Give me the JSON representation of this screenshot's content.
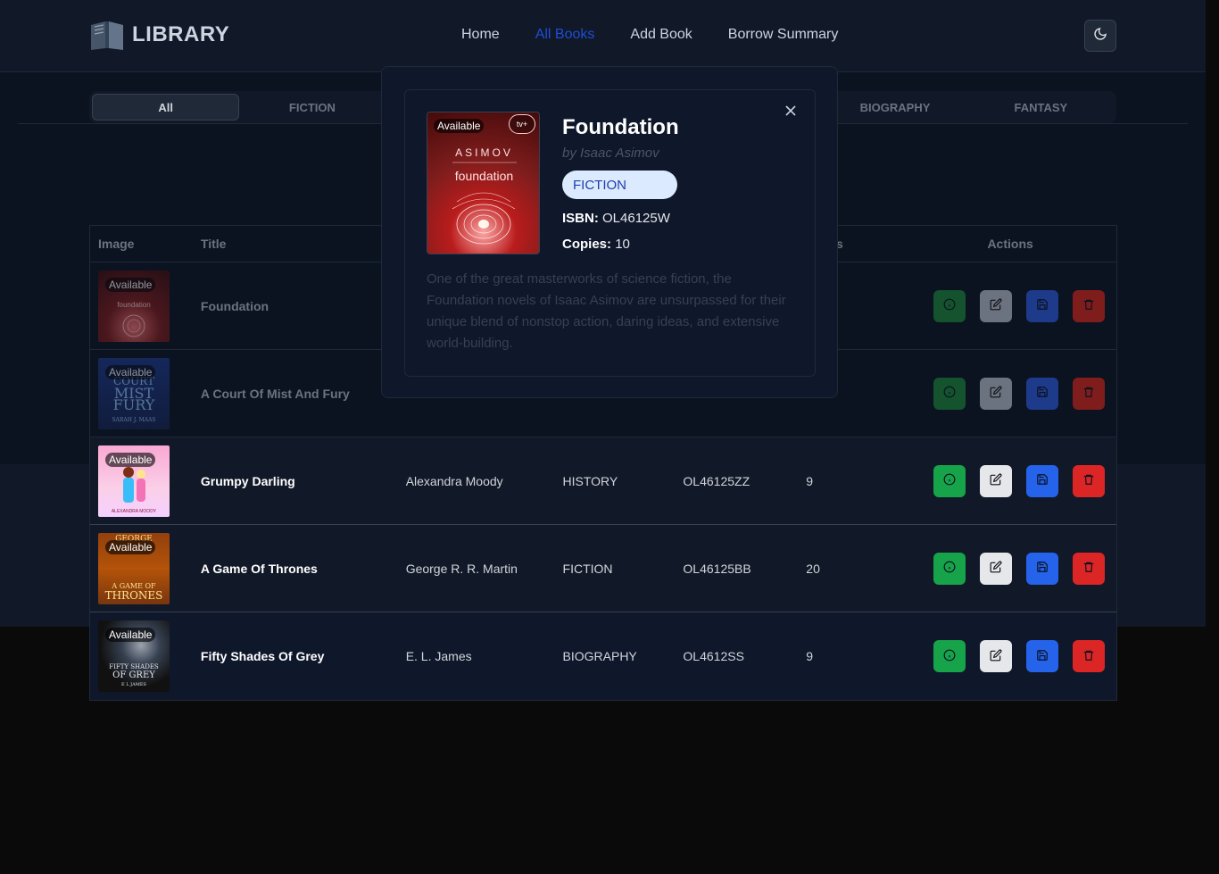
{
  "brand": {
    "name": "LIBRARY"
  },
  "nav": [
    {
      "label": "Home",
      "active": false
    },
    {
      "label": "All Books",
      "active": true
    },
    {
      "label": "Add Book",
      "active": false
    },
    {
      "label": "Borrow Summary",
      "active": false
    }
  ],
  "tabs": [
    "All",
    "FICTION",
    "",
    "",
    "",
    "BIOGRAPHY",
    "FANTASY"
  ],
  "table": {
    "headers": {
      "image": "Image",
      "title": "Title",
      "copies": "ies",
      "actions": "Actions"
    },
    "rows": [
      {
        "status": "Available",
        "title": "Foundation",
        "author": "",
        "genre": "",
        "isbn": "",
        "copies": ""
      },
      {
        "status": "Available",
        "title": "A Court Of Mist And Fury",
        "author": "",
        "genre": "",
        "isbn": "",
        "copies": ""
      },
      {
        "status": "Available",
        "title": "Grumpy Darling",
        "author": "Alexandra Moody",
        "genre": "HISTORY",
        "isbn": "OL46125ZZ",
        "copies": "9"
      },
      {
        "status": "Available",
        "title": "A Game Of Thrones",
        "author": "George R. R. Martin",
        "genre": "FICTION",
        "isbn": "OL46125BB",
        "copies": "20"
      },
      {
        "status": "Available",
        "title": "Fifty Shades Of Grey",
        "author": "E. L. James",
        "genre": "BIOGRAPHY",
        "isbn": "OL4612SS",
        "copies": "9"
      }
    ]
  },
  "modal": {
    "status": "Available",
    "title": "Foundation",
    "author": "by Isaac Asimov",
    "genre": "FICTION",
    "isbn_label": "ISBN:",
    "isbn": "OL46125W",
    "copies_label": "Copies:",
    "copies": "10",
    "description": "One of the great masterworks of science fiction, the Foundation novels of Isaac Asimov are unsurpassed for their unique blend of nonstop action, daring ideas, and extensive world-building.",
    "cover_text": {
      "top": "ASIMOV",
      "main": "foundation",
      "tag": "tv+"
    }
  },
  "icons": {
    "info": "info-icon",
    "edit": "edit-icon",
    "save": "save-icon",
    "delete": "trash-icon",
    "theme": "moon-icon",
    "close": "close-icon"
  },
  "colors": {
    "accent": "#1d4ed8",
    "info": "#16a34a",
    "edit": "#e5e7eb",
    "save": "#2563eb",
    "delete": "#dc2626",
    "genre_bg": "#dbeafe",
    "genre_text": "#1e40af"
  },
  "covers_text": {
    "foundation": "foundation",
    "court": [
      "COURT",
      "MIST",
      "FURY",
      "SARAH J. MAAS"
    ],
    "grumpy": "ALEXANDRA MOODY",
    "got": [
      "GEORGE",
      "A GAME OF",
      "THRONES"
    ],
    "fifty": [
      "FIFTY SHADES",
      "OF GREY",
      "E L JAMES"
    ]
  }
}
